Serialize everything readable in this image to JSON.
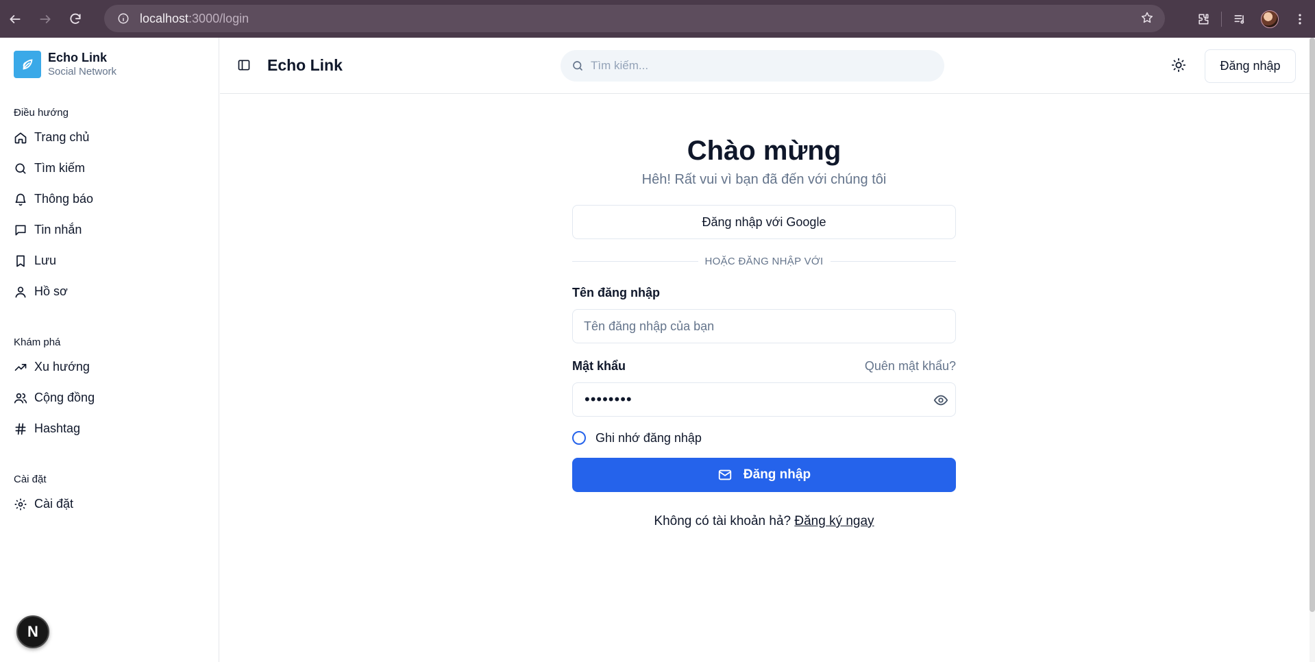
{
  "browser": {
    "url_host": "localhost",
    "url_path": ":3000/login"
  },
  "sidebar": {
    "brand_title": "Echo Link",
    "brand_subtitle": "Social Network",
    "groups": [
      {
        "label": "Điều hướng",
        "items": [
          {
            "label": "Trang chủ",
            "icon": "home-icon"
          },
          {
            "label": "Tìm kiếm",
            "icon": "search-icon"
          },
          {
            "label": "Thông báo",
            "icon": "bell-icon"
          },
          {
            "label": "Tin nhắn",
            "icon": "message-icon"
          },
          {
            "label": "Lưu",
            "icon": "bookmark-icon"
          },
          {
            "label": "Hồ sơ",
            "icon": "user-icon"
          }
        ]
      },
      {
        "label": "Khám phá",
        "items": [
          {
            "label": "Xu hướng",
            "icon": "trending-icon"
          },
          {
            "label": "Cộng đồng",
            "icon": "users-icon"
          },
          {
            "label": "Hashtag",
            "icon": "hash-icon"
          }
        ]
      },
      {
        "label": "Cài đặt",
        "items": [
          {
            "label": "Cài đặt",
            "icon": "gear-icon"
          }
        ]
      }
    ],
    "dev_badge": "N"
  },
  "header": {
    "title": "Echo Link",
    "search_placeholder": "Tìm kiếm...",
    "login_label": "Đăng nhập"
  },
  "login": {
    "title": "Chào mừng",
    "subtitle": "Hêh! Rất vui vì bạn đã đến với chúng tôi",
    "google_label": "Đăng nhập với Google",
    "divider_text": "HOẶC ĐĂNG NHẬP VỚI",
    "username_label": "Tên đăng nhập",
    "username_placeholder": "Tên đăng nhập của bạn",
    "password_label": "Mật khẩu",
    "forgot_label": "Quên mật khẩu?",
    "password_masked": "••••••••",
    "remember_label": "Ghi nhớ đăng nhập",
    "submit_label": "Đăng nhập",
    "signup_prompt": "Không có tài khoản hả?",
    "signup_link": "Đăng ký ngay"
  },
  "colors": {
    "primary": "#2563eb",
    "brand_logo": "#3aa9e8",
    "chrome_bg": "#4a3a4a"
  }
}
